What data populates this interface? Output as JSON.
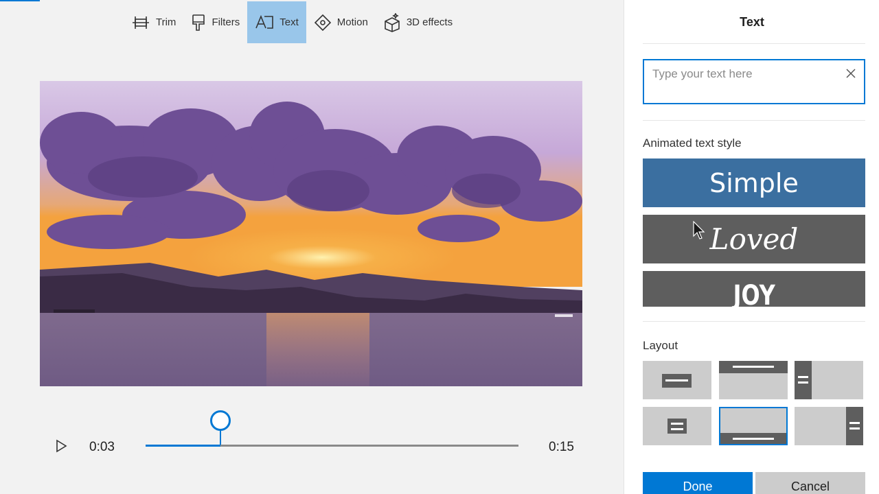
{
  "toolbar": {
    "items": [
      {
        "label": "Trim",
        "icon": "trim-icon",
        "active": false
      },
      {
        "label": "Filters",
        "icon": "filters-icon",
        "active": false
      },
      {
        "label": "Text",
        "icon": "text-icon",
        "active": true
      },
      {
        "label": "Motion",
        "icon": "motion-icon",
        "active": false
      },
      {
        "label": "3D effects",
        "icon": "3d-effects-icon",
        "active": false
      }
    ]
  },
  "playback": {
    "current_time": "0:03",
    "total_time": "0:15",
    "progress": 0.2,
    "play_icon": "play-icon"
  },
  "panel": {
    "title": "Text",
    "text_input": {
      "value": "",
      "placeholder": "Type your text here"
    },
    "animated_text_style_label": "Animated text style",
    "styles": [
      {
        "label": "Simple",
        "selected": true
      },
      {
        "label": "Loved",
        "selected": false
      },
      {
        "label": "JOY",
        "selected": false
      }
    ],
    "layout_label": "Layout",
    "selected_layout": 4,
    "done_label": "Done",
    "cancel_label": "Cancel"
  },
  "colors": {
    "accent": "#0078d4",
    "active_tool": "#99c6ea",
    "simple_style": "#3b6fa0",
    "tile_dark": "#5e5e5e"
  }
}
